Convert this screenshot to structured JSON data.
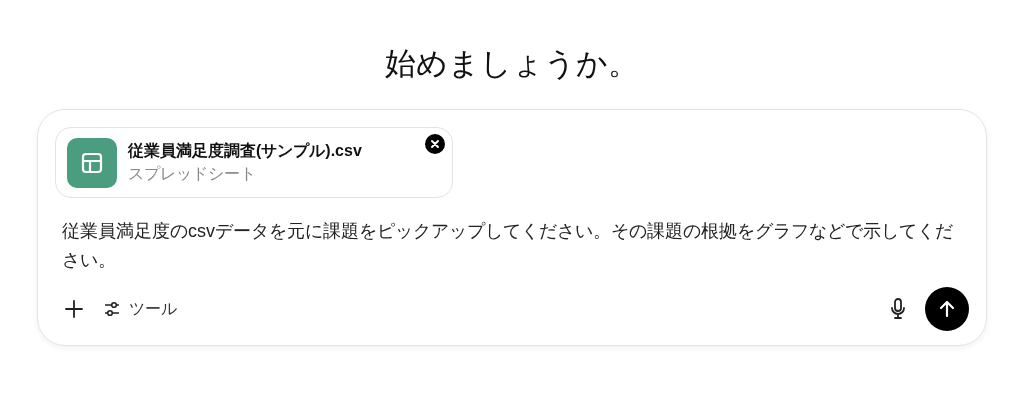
{
  "heading": "始めましょうか。",
  "attachment": {
    "name": "従業員満足度調査(サンプル).csv",
    "type": "スプレッドシート"
  },
  "message": "従業員満足度のcsvデータを元に課題をピックアップしてください。その課題の根拠をグラフなどで示してください。",
  "toolbar": {
    "tools_label": "ツール"
  }
}
